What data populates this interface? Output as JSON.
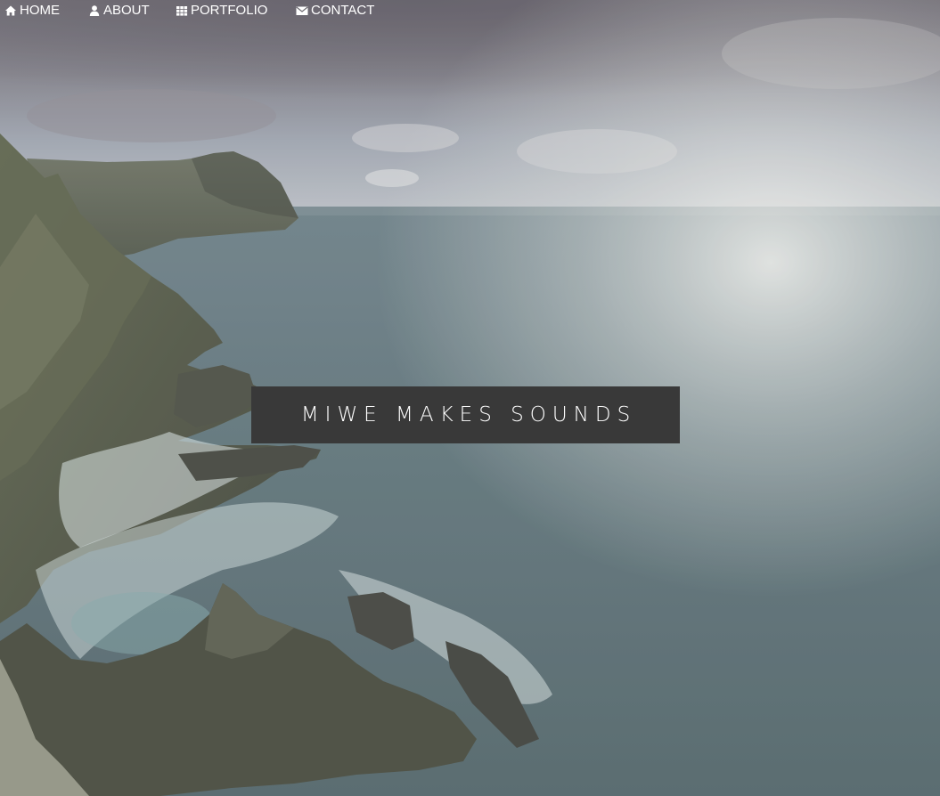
{
  "nav": {
    "items": [
      {
        "label": "HOME",
        "icon": "home-icon"
      },
      {
        "label": "ABOUT",
        "icon": "user-icon"
      },
      {
        "label": "PORTFOLIO",
        "icon": "grid-icon"
      },
      {
        "label": "CONTACT",
        "icon": "envelope-icon"
      }
    ]
  },
  "hero": {
    "title": "MIWE MAKES SOUNDS",
    "image": "coastal-cliffs-and-sea"
  },
  "colors": {
    "title_box_bg": "#393939",
    "nav_text": "#ffffff",
    "sea": "#5d7378",
    "sky": "#8d8c93",
    "cliff": "#4c5244"
  }
}
